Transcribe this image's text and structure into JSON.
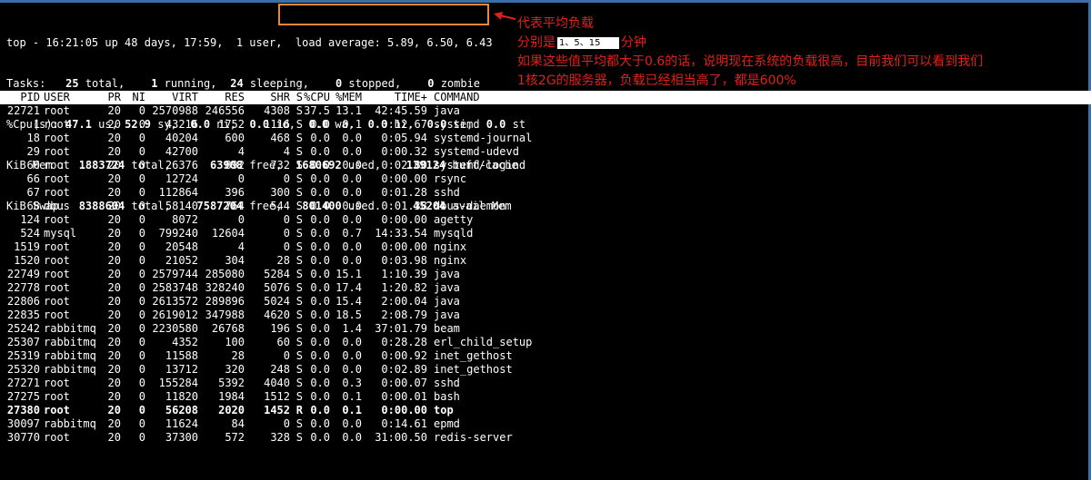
{
  "summary": {
    "top_line_prefix": "top - 16:21:05 up 48 days, 17:59,  1 user,  ",
    "load_average": "load average: 5.89, 6.50, 6.43",
    "tasks": {
      "label": "Tasks:",
      "total": "25",
      "total_label": "total,",
      "running": "1",
      "running_label": "running,",
      "sleeping": "24",
      "sleeping_label": "sleeping,",
      "stopped": "0",
      "stopped_label": "stopped,",
      "zombie": "0",
      "zombie_label": "zombie"
    },
    "cpu": {
      "label": "%Cpu(s):",
      "us": "47.1",
      "us_label": "us,",
      "sy": "52.9",
      "sy_label": "sy,",
      "ni": "0.0",
      "ni_label": "ni,",
      "id": "0.0",
      "id_label": "id,",
      "wa": "0.0",
      "wa_label": "wa,",
      "hi": "0.0",
      "hi_label": "hi,",
      "si": "0.0",
      "si_label": "si,",
      "st": "0.0",
      "st_label": "st"
    },
    "mem": {
      "label": "KiB Mem :",
      "total": "1883724",
      "total_label": "total,",
      "free": "63908",
      "free_label": "free,",
      "used": "1680692",
      "used_label": "used,",
      "buff": "139124",
      "buff_label": "buff/cache"
    },
    "swap": {
      "label": "KiB Swap:",
      "total": "8388604",
      "total_label": "total,",
      "free": "7587204",
      "free_label": "free,",
      "used": "801400",
      "used_label": "used.",
      "avail": "45204",
      "avail_label": "avail Mem"
    }
  },
  "annotation": {
    "title": "代表平均负载",
    "periods_prefix": "分别是",
    "periods_highlight": "1、5、15",
    "periods_suffix": "分钟",
    "line3": "如果这些值平均都大于0.6的话，说明现在系统的负载很高，目前我们可以看到我们",
    "line4": "1核2G的服务器，负载已经相当高了，都是600%",
    "color": "#e0201a",
    "box_color": "#e8863a"
  },
  "table": {
    "headers": {
      "pid": "PID",
      "user": "USER",
      "pr": "PR",
      "ni": "NI",
      "virt": "VIRT",
      "res": "RES",
      "shr": "SHR",
      "s": "S",
      "cpu": "%CPU",
      "mem": "%MEM",
      "time": "TIME+",
      "cmd": "COMMAND"
    },
    "rows": [
      {
        "pid": "22721",
        "user": "root",
        "pr": "20",
        "ni": "0",
        "virt": "2570988",
        "res": "246556",
        "shr": "4308",
        "s": "S",
        "cpu": "37.5",
        "mem": "13.1",
        "time": "42:45.59",
        "cmd": "java"
      },
      {
        "pid": "1",
        "user": "root",
        "pr": "20",
        "ni": "0",
        "virt": "43216",
        "res": "1752",
        "shr": "1116",
        "s": "S",
        "cpu": "0.0",
        "mem": "0.1",
        "time": "0:12.67",
        "cmd": "systemd"
      },
      {
        "pid": "18",
        "user": "root",
        "pr": "20",
        "ni": "0",
        "virt": "40204",
        "res": "600",
        "shr": "468",
        "s": "S",
        "cpu": "0.0",
        "mem": "0.0",
        "time": "0:05.94",
        "cmd": "systemd-journal"
      },
      {
        "pid": "29",
        "user": "root",
        "pr": "20",
        "ni": "0",
        "virt": "42700",
        "res": "4",
        "shr": "4",
        "s": "S",
        "cpu": "0.0",
        "mem": "0.0",
        "time": "0:00.32",
        "cmd": "systemd-udevd"
      },
      {
        "pid": "60",
        "user": "root",
        "pr": "20",
        "ni": "0",
        "virt": "26376",
        "res": "892",
        "shr": "732",
        "s": "S",
        "cpu": "0.0",
        "mem": "0.0",
        "time": "0:02.80",
        "cmd": "systemd-logind"
      },
      {
        "pid": "66",
        "user": "root",
        "pr": "20",
        "ni": "0",
        "virt": "12724",
        "res": "0",
        "shr": "0",
        "s": "S",
        "cpu": "0.0",
        "mem": "0.0",
        "time": "0:00.00",
        "cmd": "rsync"
      },
      {
        "pid": "67",
        "user": "root",
        "pr": "20",
        "ni": "0",
        "virt": "112864",
        "res": "396",
        "shr": "300",
        "s": "S",
        "cpu": "0.0",
        "mem": "0.0",
        "time": "0:01.28",
        "cmd": "sshd"
      },
      {
        "pid": "68",
        "user": "dbus",
        "pr": "20",
        "ni": "0",
        "virt": "58140",
        "res": "764",
        "shr": "544",
        "s": "S",
        "cpu": "0.0",
        "mem": "0.0",
        "time": "0:01.38",
        "cmd": "dbus-daemon"
      },
      {
        "pid": "124",
        "user": "root",
        "pr": "20",
        "ni": "0",
        "virt": "8072",
        "res": "0",
        "shr": "0",
        "s": "S",
        "cpu": "0.0",
        "mem": "0.0",
        "time": "0:00.00",
        "cmd": "agetty"
      },
      {
        "pid": "524",
        "user": "mysql",
        "pr": "20",
        "ni": "0",
        "virt": "799240",
        "res": "12604",
        "shr": "0",
        "s": "S",
        "cpu": "0.0",
        "mem": "0.7",
        "time": "14:33.54",
        "cmd": "mysqld"
      },
      {
        "pid": "1519",
        "user": "root",
        "pr": "20",
        "ni": "0",
        "virt": "20548",
        "res": "4",
        "shr": "0",
        "s": "S",
        "cpu": "0.0",
        "mem": "0.0",
        "time": "0:00.00",
        "cmd": "nginx"
      },
      {
        "pid": "1520",
        "user": "root",
        "pr": "20",
        "ni": "0",
        "virt": "21052",
        "res": "304",
        "shr": "28",
        "s": "S",
        "cpu": "0.0",
        "mem": "0.0",
        "time": "0:03.98",
        "cmd": "nginx"
      },
      {
        "pid": "22749",
        "user": "root",
        "pr": "20",
        "ni": "0",
        "virt": "2579744",
        "res": "285080",
        "shr": "5284",
        "s": "S",
        "cpu": "0.0",
        "mem": "15.1",
        "time": "1:10.39",
        "cmd": "java"
      },
      {
        "pid": "22778",
        "user": "root",
        "pr": "20",
        "ni": "0",
        "virt": "2583748",
        "res": "328240",
        "shr": "5076",
        "s": "S",
        "cpu": "0.0",
        "mem": "17.4",
        "time": "1:20.82",
        "cmd": "java"
      },
      {
        "pid": "22806",
        "user": "root",
        "pr": "20",
        "ni": "0",
        "virt": "2613572",
        "res": "289896",
        "shr": "5024",
        "s": "S",
        "cpu": "0.0",
        "mem": "15.4",
        "time": "2:00.04",
        "cmd": "java"
      },
      {
        "pid": "22835",
        "user": "root",
        "pr": "20",
        "ni": "0",
        "virt": "2619012",
        "res": "347988",
        "shr": "4620",
        "s": "S",
        "cpu": "0.0",
        "mem": "18.5",
        "time": "2:08.79",
        "cmd": "java"
      },
      {
        "pid": "25242",
        "user": "rabbitmq",
        "pr": "20",
        "ni": "0",
        "virt": "2230580",
        "res": "26768",
        "shr": "196",
        "s": "S",
        "cpu": "0.0",
        "mem": "1.4",
        "time": "37:01.79",
        "cmd": "beam"
      },
      {
        "pid": "25307",
        "user": "rabbitmq",
        "pr": "20",
        "ni": "0",
        "virt": "4352",
        "res": "100",
        "shr": "60",
        "s": "S",
        "cpu": "0.0",
        "mem": "0.0",
        "time": "0:28.28",
        "cmd": "erl_child_setup"
      },
      {
        "pid": "25319",
        "user": "rabbitmq",
        "pr": "20",
        "ni": "0",
        "virt": "11588",
        "res": "28",
        "shr": "0",
        "s": "S",
        "cpu": "0.0",
        "mem": "0.0",
        "time": "0:00.92",
        "cmd": "inet_gethost"
      },
      {
        "pid": "25320",
        "user": "rabbitmq",
        "pr": "20",
        "ni": "0",
        "virt": "13712",
        "res": "320",
        "shr": "248",
        "s": "S",
        "cpu": "0.0",
        "mem": "0.0",
        "time": "0:02.89",
        "cmd": "inet_gethost"
      },
      {
        "pid": "27271",
        "user": "root",
        "pr": "20",
        "ni": "0",
        "virt": "155284",
        "res": "5392",
        "shr": "4040",
        "s": "S",
        "cpu": "0.0",
        "mem": "0.3",
        "time": "0:00.07",
        "cmd": "sshd"
      },
      {
        "pid": "27275",
        "user": "root",
        "pr": "20",
        "ni": "0",
        "virt": "11820",
        "res": "1984",
        "shr": "1512",
        "s": "S",
        "cpu": "0.0",
        "mem": "0.1",
        "time": "0:00.01",
        "cmd": "bash"
      },
      {
        "pid": "27380",
        "user": "root",
        "pr": "20",
        "ni": "0",
        "virt": "56208",
        "res": "2020",
        "shr": "1452",
        "s": "R",
        "cpu": "0.0",
        "mem": "0.1",
        "time": "0:00.00",
        "cmd": "top",
        "bold": true
      },
      {
        "pid": "30097",
        "user": "rabbitmq",
        "pr": "20",
        "ni": "0",
        "virt": "11624",
        "res": "84",
        "shr": "0",
        "s": "S",
        "cpu": "0.0",
        "mem": "0.0",
        "time": "0:14.61",
        "cmd": "epmd"
      },
      {
        "pid": "30770",
        "user": "root",
        "pr": "20",
        "ni": "0",
        "virt": "37300",
        "res": "572",
        "shr": "328",
        "s": "S",
        "cpu": "0.0",
        "mem": "0.0",
        "time": "31:00.50",
        "cmd": "redis-server"
      }
    ]
  }
}
